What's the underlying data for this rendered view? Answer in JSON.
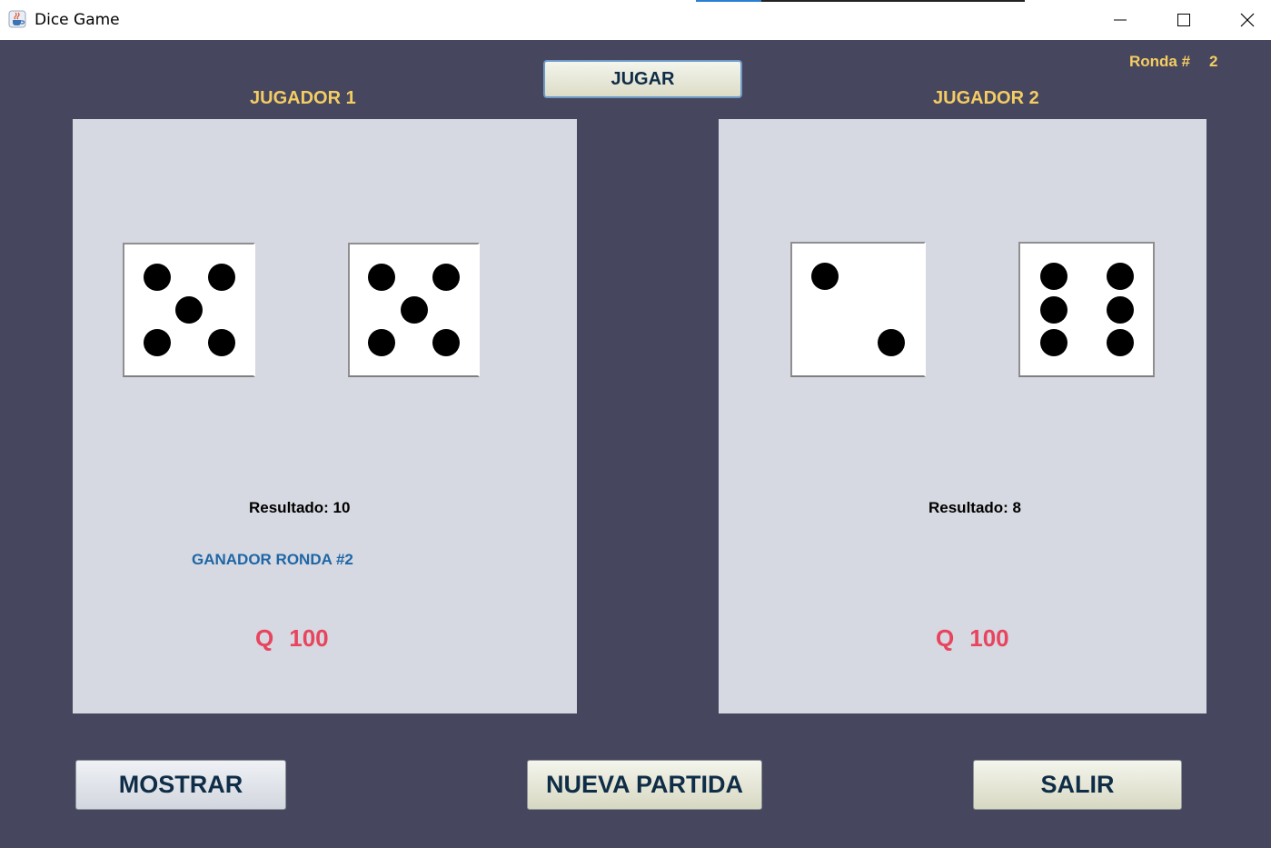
{
  "window": {
    "title": "Dice Game"
  },
  "header": {
    "round_label": "Ronda #",
    "round_number": "2",
    "play_button": "JUGAR"
  },
  "player1": {
    "title": "JUGADOR 1",
    "dice": [
      5,
      5
    ],
    "result_label": "Resultado: 10",
    "status": "GANADOR RONDA #2",
    "currency": "Q",
    "amount": "100"
  },
  "player2": {
    "title": "JUGADOR 2",
    "dice": [
      2,
      6
    ],
    "result_label": "Resultado: 8",
    "currency": "Q",
    "amount": "100"
  },
  "footer": {
    "show_button": "MOSTRAR",
    "new_game_button": "NUEVA PARTIDA",
    "exit_button": "SALIR"
  },
  "colors": {
    "background": "#47465f",
    "panel": "#d6d9e1",
    "gold_text": "#f4cd62",
    "money_text": "#e8445e",
    "winner_text": "#1e66a6",
    "button_text": "#0f2d47"
  },
  "icons": {
    "app": "java-cup-icon",
    "minimize": "minimize-icon",
    "maximize": "maximize-icon",
    "close": "close-icon"
  }
}
